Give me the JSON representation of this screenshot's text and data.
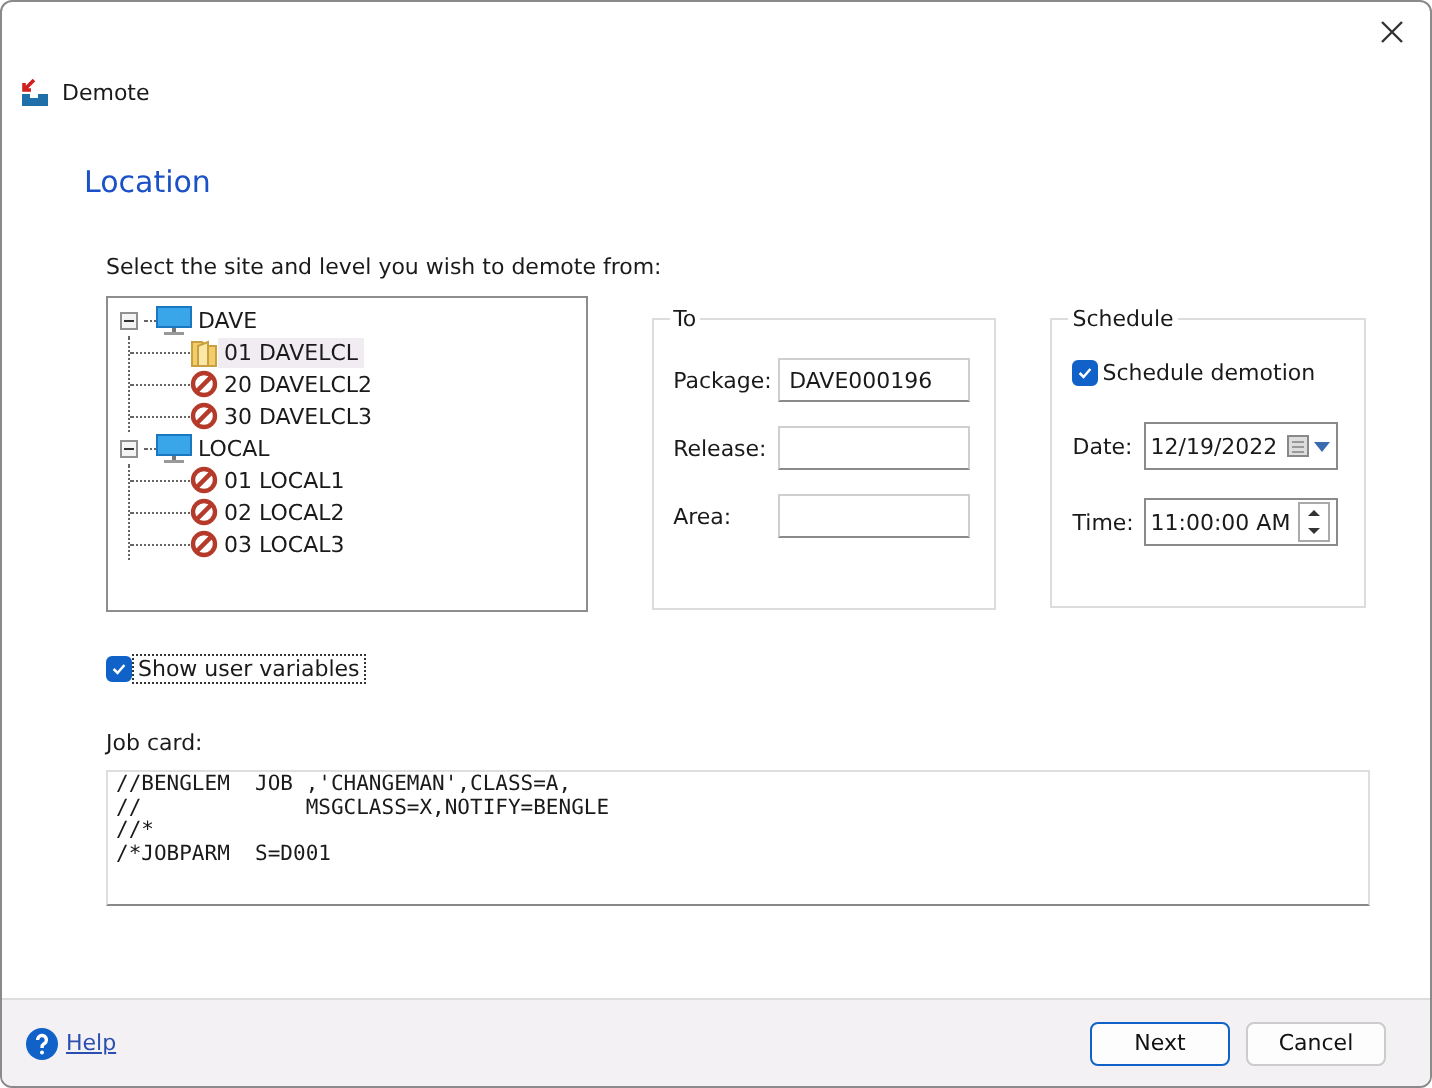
{
  "window": {
    "title": "Demote"
  },
  "page_heading": "Location",
  "tree": {
    "label": "Select the site and level you wish to demote from:",
    "items": [
      {
        "kind": "site",
        "label": "DAVE",
        "expanded": true,
        "selected": false,
        "children": [
          {
            "kind": "open",
            "label": "01  DAVELCL",
            "selected": true
          },
          {
            "kind": "blocked",
            "label": "20  DAVELCL2",
            "selected": false
          },
          {
            "kind": "blocked",
            "label": "30  DAVELCL3",
            "selected": false
          }
        ]
      },
      {
        "kind": "site",
        "label": "LOCAL",
        "expanded": true,
        "selected": false,
        "children": [
          {
            "kind": "blocked",
            "label": "01  LOCAL1",
            "selected": false
          },
          {
            "kind": "blocked",
            "label": "02  LOCAL2",
            "selected": false
          },
          {
            "kind": "blocked",
            "label": "03  LOCAL3",
            "selected": false
          }
        ]
      }
    ]
  },
  "to": {
    "title": "To",
    "fields": [
      {
        "label": "Package:",
        "value": "DAVE000196"
      },
      {
        "label": "Release:"
      },
      {
        "label": "Area:"
      }
    ]
  },
  "schedule": {
    "title": "Schedule",
    "checkbox": {
      "label": "Schedule demotion",
      "checked": true
    },
    "date": {
      "label": "Date:",
      "value": "12/19/2022"
    },
    "time": {
      "label": "Time:",
      "value": "11:00:00 AM"
    }
  },
  "show_user_variables": {
    "label": "Show user variables",
    "checked": true
  },
  "job_card": {
    "label": "Job card:",
    "lines": [
      "//BENGLEM  JOB ,'CHANGEMAN',CLASS=A,",
      "//             MSGCLASS=X,NOTIFY=BENGLE",
      "//*",
      "/*JOBPARM  S=D001"
    ]
  },
  "footer": {
    "help": "Help",
    "buttons": [
      {
        "label": "Next",
        "kind": "default"
      },
      {
        "label": "Cancel",
        "kind": "normal"
      }
    ]
  }
}
